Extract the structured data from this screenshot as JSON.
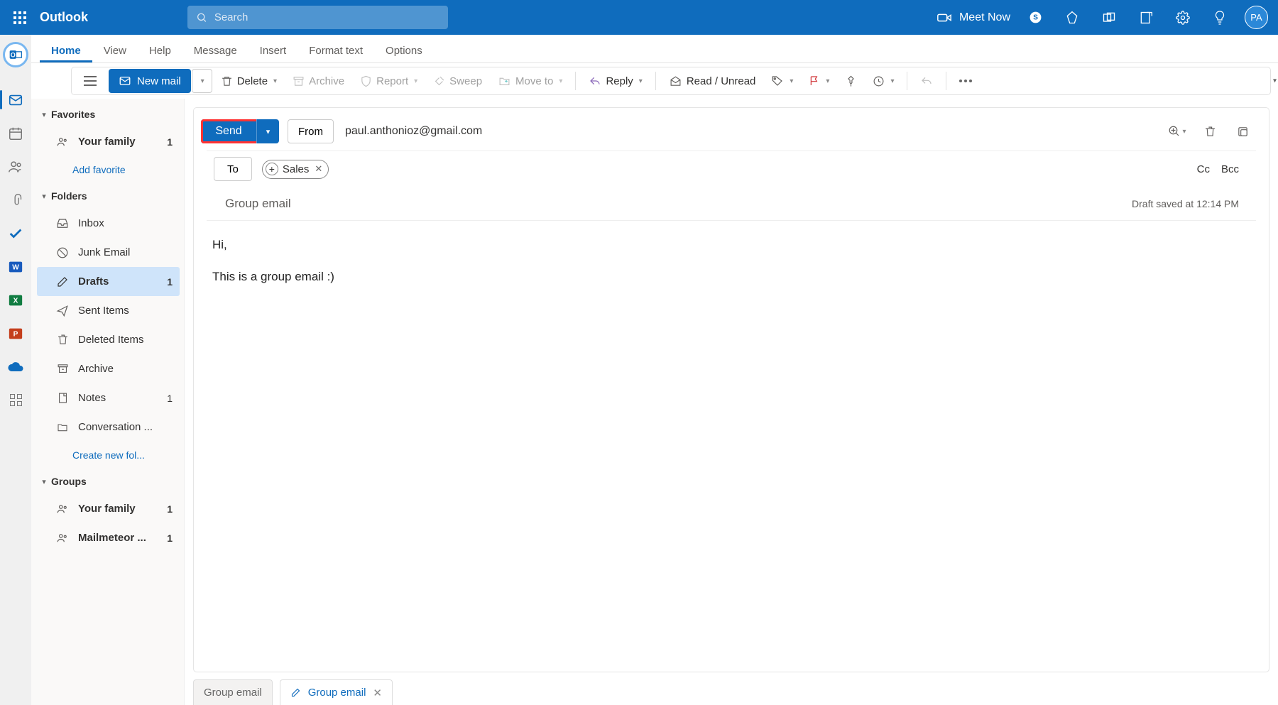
{
  "header": {
    "brand": "Outlook",
    "search_placeholder": "Search",
    "meet_now": "Meet Now",
    "avatar_initials": "PA"
  },
  "tabs": [
    "Home",
    "View",
    "Help",
    "Message",
    "Insert",
    "Format text",
    "Options"
  ],
  "active_tab": "Home",
  "ribbon": {
    "new_mail": "New mail",
    "delete": "Delete",
    "archive": "Archive",
    "report": "Report",
    "sweep": "Sweep",
    "move_to": "Move to",
    "reply": "Reply",
    "read_unread": "Read / Unread"
  },
  "folders": {
    "favorites_label": "Favorites",
    "favorites": [
      {
        "name": "Your family",
        "count": "1",
        "bold": true
      }
    ],
    "add_favorite": "Add favorite",
    "folders_label": "Folders",
    "items": [
      {
        "name": "Inbox",
        "icon": "inbox",
        "count": "",
        "bold": false,
        "active": false
      },
      {
        "name": "Junk Email",
        "icon": "junk",
        "count": "",
        "bold": false,
        "active": false
      },
      {
        "name": "Drafts",
        "icon": "drafts",
        "count": "1",
        "bold": true,
        "active": true
      },
      {
        "name": "Sent Items",
        "icon": "sent",
        "count": "",
        "bold": false,
        "active": false
      },
      {
        "name": "Deleted Items",
        "icon": "deleted",
        "count": "",
        "bold": false,
        "active": false
      },
      {
        "name": "Archive",
        "icon": "archive",
        "count": "",
        "bold": false,
        "active": false
      },
      {
        "name": "Notes",
        "icon": "notes",
        "count": "1",
        "bold": false,
        "active": false
      },
      {
        "name": "Conversation ...",
        "icon": "folder",
        "count": "",
        "bold": false,
        "active": false
      }
    ],
    "create_folder": "Create new fol...",
    "groups_label": "Groups",
    "groups": [
      {
        "name": "Your family",
        "count": "1",
        "bold": true
      },
      {
        "name": "Mailmeteor ...",
        "count": "1",
        "bold": true
      }
    ]
  },
  "compose": {
    "send": "Send",
    "from": "From",
    "from_addr": "paul.anthonioz@gmail.com",
    "to": "To",
    "chip": "Sales",
    "cc": "Cc",
    "bcc": "Bcc",
    "subject": "Group email",
    "draft_info": "Draft saved at 12:14 PM",
    "body_line1": "Hi,",
    "body_line2": "This is a group email :)"
  },
  "bottom_tabs": {
    "inactive": "Group email",
    "active": "Group email"
  }
}
